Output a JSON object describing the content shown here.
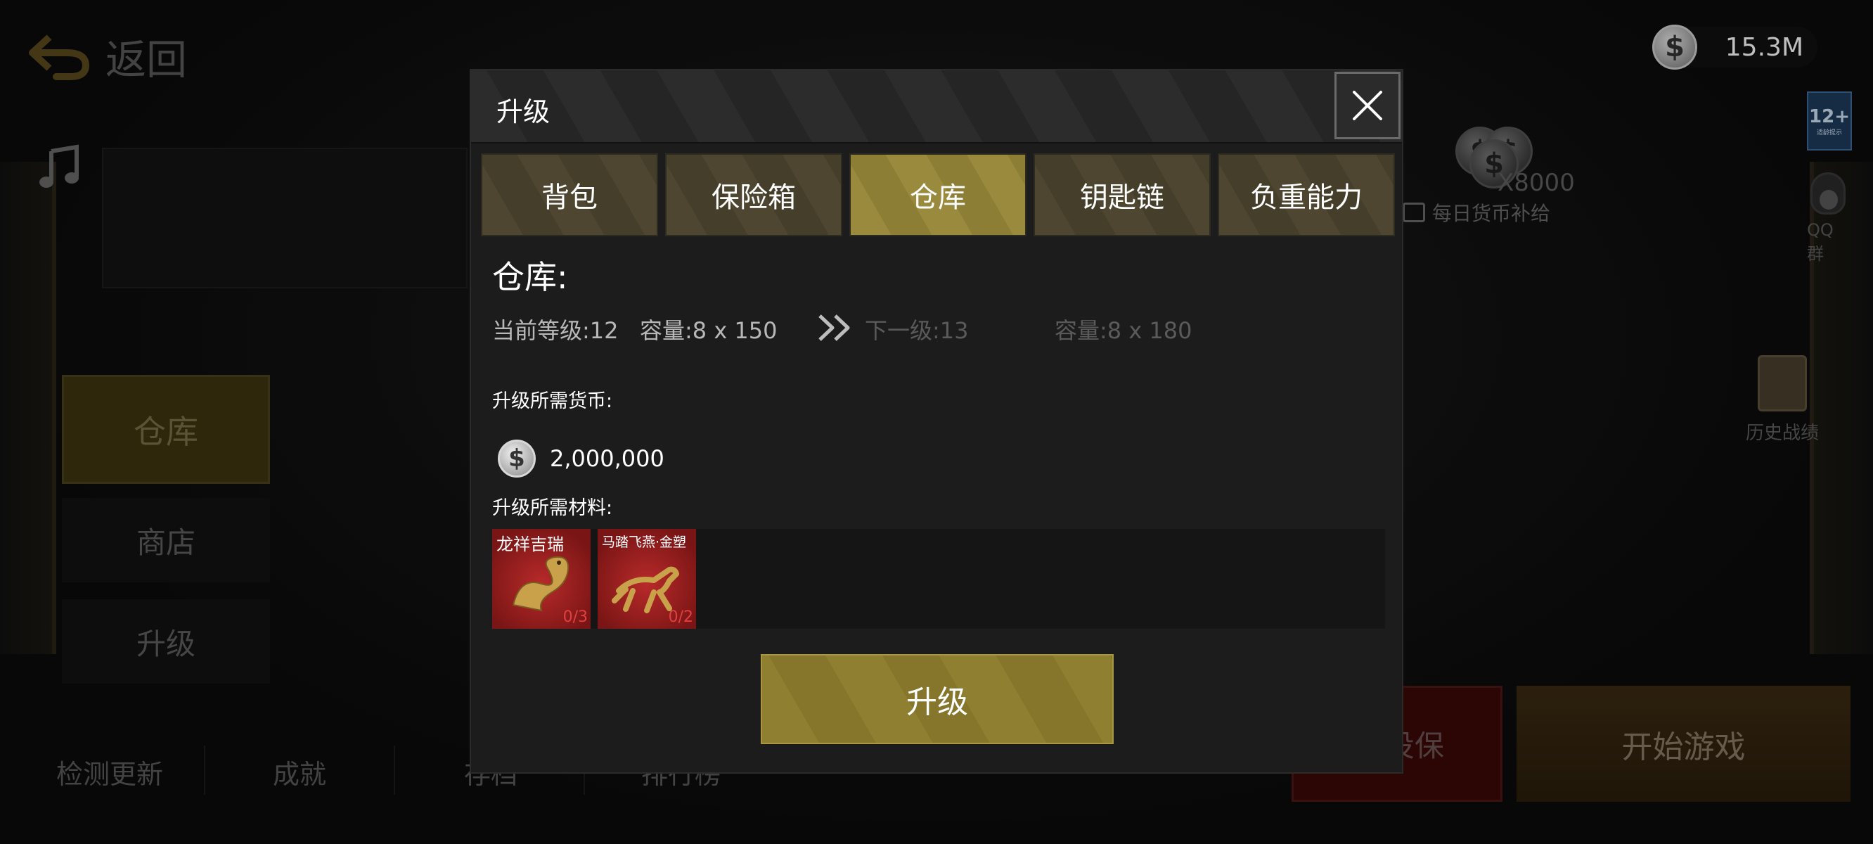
{
  "background": {
    "back_label": "返回",
    "currency_value": "15.3M",
    "age_rating": {
      "num": "12+",
      "text": "适龄提示"
    },
    "daily_amount": "X8000",
    "daily_label": "每日货币补给",
    "qq_label": "QQ群",
    "history_label": "历史战绩",
    "side_nav": [
      {
        "label": "仓库"
      },
      {
        "label": "商店"
      },
      {
        "label": "升级"
      }
    ],
    "bottom_nav": [
      {
        "label": "检测更新"
      },
      {
        "label": "成就"
      },
      {
        "label": "存档"
      },
      {
        "label": "排行榜"
      }
    ],
    "insurance_label": "投保",
    "start_label": "开始游戏"
  },
  "modal": {
    "title": "升级",
    "tabs": [
      {
        "label": "背包"
      },
      {
        "label": "保险箱"
      },
      {
        "label": "仓库"
      },
      {
        "label": "钥匙链"
      },
      {
        "label": "负重能力"
      }
    ],
    "active_tab": "仓库",
    "section_title": "仓库:",
    "current_level": "当前等级:12",
    "current_capacity": "容量:8 x 150",
    "next_level": "下一级:13",
    "next_capacity": "容量:8 x 180",
    "currency_label": "升级所需货币:",
    "currency_amount": "2,000,000",
    "materials_label": "升级所需材料:",
    "materials": [
      {
        "name": "龙祥吉瑞",
        "count": "0/3"
      },
      {
        "name": "马踏飞燕·金塑",
        "count": "0/2"
      }
    ],
    "upgrade_label": "升级"
  },
  "colors": {
    "accent_gold": "#8d7e36",
    "tab_inactive": "#4e4630",
    "material_bg": "#b82a2a",
    "material_count": "#e04040"
  }
}
